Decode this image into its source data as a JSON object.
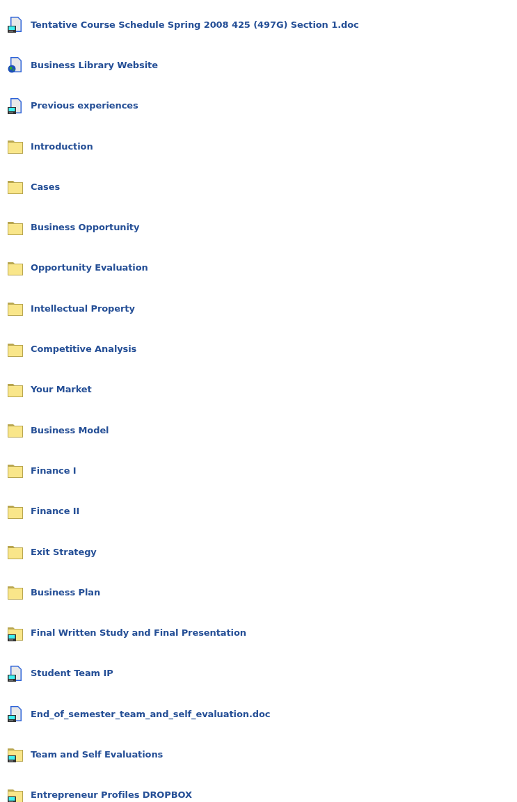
{
  "items": [
    {
      "kind": "document",
      "label": "Tentative Course Schedule Spring 2008 425 (497G) Section 1.doc"
    },
    {
      "kind": "link",
      "label": "Business Library Website"
    },
    {
      "kind": "document",
      "label": "Previous experiences"
    },
    {
      "kind": "folder",
      "label": "Introduction"
    },
    {
      "kind": "folder",
      "label": "Cases"
    },
    {
      "kind": "folder",
      "label": "Business Opportunity"
    },
    {
      "kind": "folder",
      "label": "Opportunity Evaluation"
    },
    {
      "kind": "folder",
      "label": "Intellectual Property"
    },
    {
      "kind": "folder",
      "label": "Competitive Analysis"
    },
    {
      "kind": "folder",
      "label": "Your Market"
    },
    {
      "kind": "folder",
      "label": "Business Model"
    },
    {
      "kind": "folder",
      "label": "Finance I"
    },
    {
      "kind": "folder",
      "label": "Finance II"
    },
    {
      "kind": "folder",
      "label": "Exit Strategy"
    },
    {
      "kind": "folder",
      "label": "Business Plan"
    },
    {
      "kind": "shared_folder",
      "label": "Final Written Study and Final Presentation"
    },
    {
      "kind": "document",
      "label": "Student Team IP"
    },
    {
      "kind": "document",
      "label": "End_of_semester_team_and_self_evaluation.doc"
    },
    {
      "kind": "shared_folder",
      "label": "Team and Self Evaluations"
    },
    {
      "kind": "shared_folder",
      "label": "Entrepreneur Profiles DROPBOX"
    }
  ]
}
